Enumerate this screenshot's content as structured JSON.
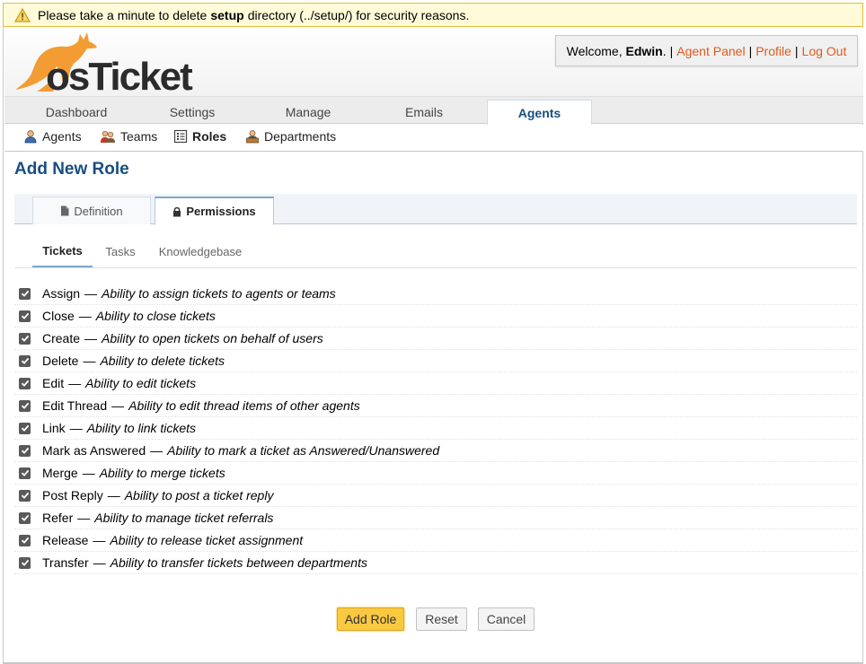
{
  "warning": {
    "prefix": "Please take a minute to delete",
    "bold": "setup",
    "suffix": "directory (../setup/) for security reasons."
  },
  "header": {
    "logo_text": "osTicket",
    "welcome_prefix": "Welcome,",
    "username": "Edwin",
    "welcome_suffix": ".",
    "sep": "|",
    "links": [
      "Agent Panel",
      "Profile",
      "Log Out"
    ]
  },
  "nav": {
    "tabs": [
      "Dashboard",
      "Settings",
      "Manage",
      "Emails",
      "Agents"
    ],
    "active": "Agents"
  },
  "subnav": {
    "items": [
      "Agents",
      "Teams",
      "Roles",
      "Departments"
    ],
    "active": "Roles"
  },
  "page_title": "Add New Role",
  "role_tabs": [
    "Definition",
    "Permissions"
  ],
  "permission_tabs": [
    "Tickets",
    "Tasks",
    "Knowledgebase"
  ],
  "permissions": [
    {
      "name": "Assign",
      "desc": "Ability to assign tickets to agents or teams",
      "checked": true
    },
    {
      "name": "Close",
      "desc": "Ability to close tickets",
      "checked": true
    },
    {
      "name": "Create",
      "desc": "Ability to open tickets on behalf of users",
      "checked": true
    },
    {
      "name": "Delete",
      "desc": "Ability to delete tickets",
      "checked": true
    },
    {
      "name": "Edit",
      "desc": "Ability to edit tickets",
      "checked": true
    },
    {
      "name": "Edit Thread",
      "desc": "Ability to edit thread items of other agents",
      "checked": true
    },
    {
      "name": "Link",
      "desc": "Ability to link tickets",
      "checked": true
    },
    {
      "name": "Mark as Answered",
      "desc": "Ability to mark a ticket as Answered/Unanswered",
      "checked": true
    },
    {
      "name": "Merge",
      "desc": "Ability to merge tickets",
      "checked": true
    },
    {
      "name": "Post Reply",
      "desc": "Ability to post a ticket reply",
      "checked": true
    },
    {
      "name": "Refer",
      "desc": "Ability to manage ticket referrals",
      "checked": true
    },
    {
      "name": "Release",
      "desc": "Ability to release ticket assignment",
      "checked": true
    },
    {
      "name": "Transfer",
      "desc": "Ability to transfer tickets between departments",
      "checked": true
    }
  ],
  "dash": "—",
  "buttons": {
    "add_role": "Add Role",
    "reset": "Reset",
    "cancel": "Cancel"
  },
  "colors": {
    "accent": "#184e81",
    "link": "#e05a1c",
    "logo_orange": "#f39c33",
    "primary_button": "#f9c941"
  }
}
